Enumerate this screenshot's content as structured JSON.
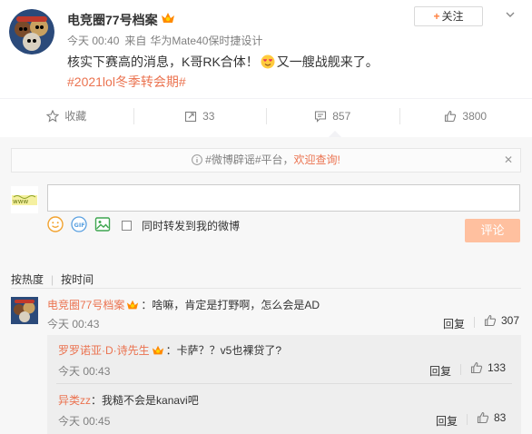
{
  "post": {
    "author": "电竞圈77号档案",
    "follow_label": "关注",
    "time": "今天 00:40",
    "source_prefix": "来自",
    "source": "华为Mate40保时捷设计",
    "text_before": "核实下赛高的消息，K哥RK合体！",
    "text_after": "又一艘战舰来了。",
    "hashtag": "#2021lol冬季转会期#"
  },
  "actions": {
    "favorite": "收藏",
    "repost": "33",
    "comment": "857",
    "like": "3800"
  },
  "comments_panel": {
    "notice_prefix": "#微博辟谣#平台，",
    "notice_link": "欢迎查询!",
    "input_placeholder": "",
    "sync_label": "同时转发到我的微博",
    "submit_label": "评论",
    "sort_hot": "按热度",
    "sort_time": "按时间"
  },
  "comments": [
    {
      "user": "电竞圈77号档案",
      "text": "：啥嘛，肯定是打野啊，怎么会是AD",
      "time": "今天 00:43",
      "reply_label": "回复",
      "likes": "307"
    }
  ],
  "sub_comments": [
    {
      "user": "罗罗诺亚·D·诗先生",
      "text": "：卡萨？？v5也裸贷了?",
      "time": "今天 00:43",
      "reply_label": "回复",
      "likes": "133"
    },
    {
      "user": "异类zz",
      "text": "：我糙不会是kanavi吧",
      "time": "今天 00:45",
      "reply_label": "回复",
      "likes": "83"
    }
  ],
  "colors": {
    "accent": "#eb7350",
    "submit_disabled": "#ffc09f",
    "panel_bg": "#f7f7f7"
  }
}
